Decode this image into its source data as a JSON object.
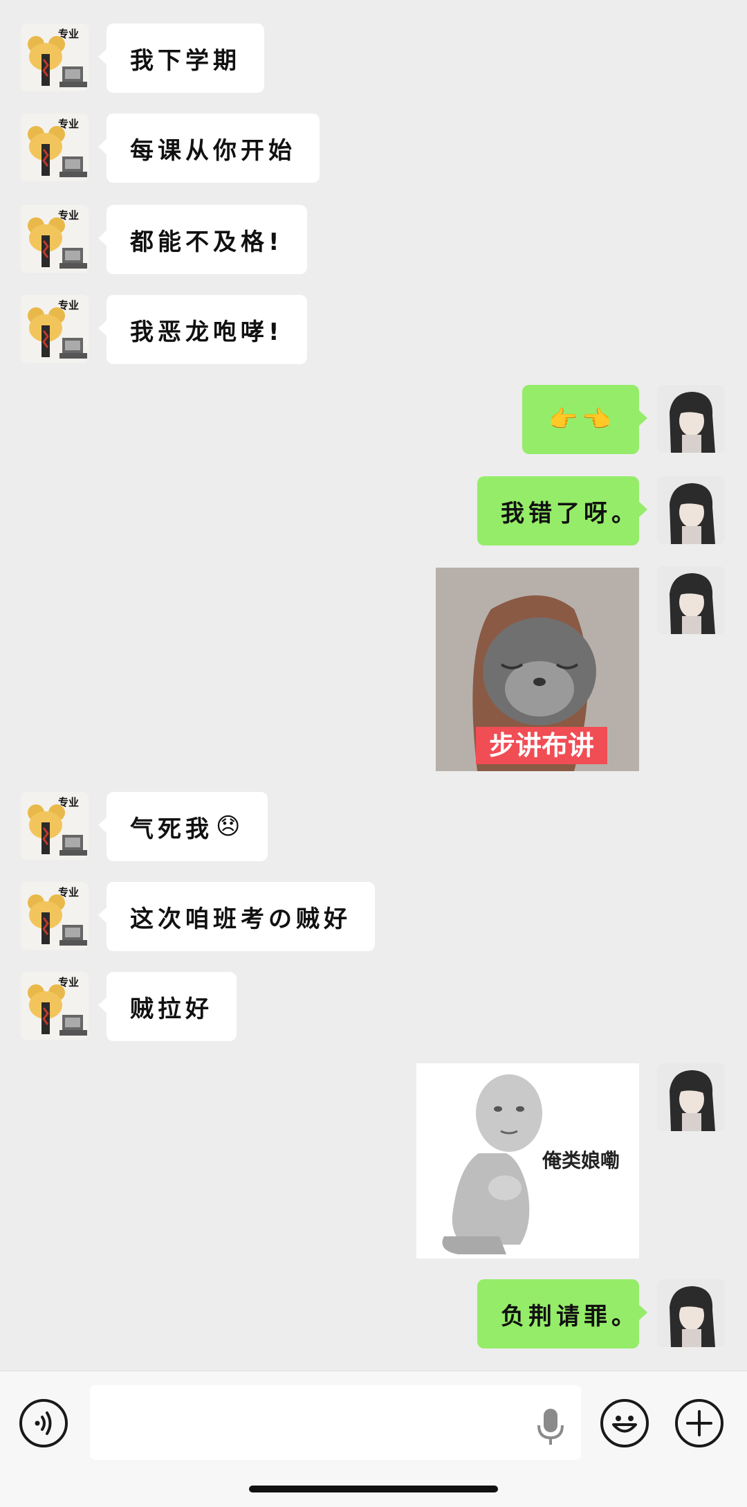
{
  "contacts": {
    "other": {
      "avatar_label": "专业"
    },
    "me": {}
  },
  "messages": [
    {
      "side": "left",
      "text": "我下学期"
    },
    {
      "side": "left",
      "text": "每课从你开始"
    },
    {
      "side": "left",
      "text": "都能不及格!"
    },
    {
      "side": "left",
      "text": "我恶龙咆哮!"
    },
    {
      "side": "right",
      "text": "",
      "emoji": "👉👈"
    },
    {
      "side": "right",
      "text": "我错了呀。"
    },
    {
      "side": "right",
      "sticker": "cat",
      "sticker_caption": "步讲布讲"
    },
    {
      "side": "left",
      "text": "气死我",
      "emoji": "😞"
    },
    {
      "side": "left",
      "text": "这次咱班考の贼好"
    },
    {
      "side": "left",
      "text": "贼拉好"
    },
    {
      "side": "right",
      "sticker": "kneeling-figure",
      "sticker_caption": "俺类娘嘞"
    },
    {
      "side": "right",
      "text": "负荆请罪。"
    }
  ],
  "input": {
    "value": "",
    "placeholder": ""
  },
  "icons": {
    "voice": "voice-icon",
    "mic": "microphone-icon",
    "emoji": "emoji-icon",
    "more": "plus-icon"
  },
  "colors": {
    "background": "#ededed",
    "received_bubble": "#ffffff",
    "sent_bubble": "#95ec69",
    "bottom_bar": "#f7f7f7"
  }
}
